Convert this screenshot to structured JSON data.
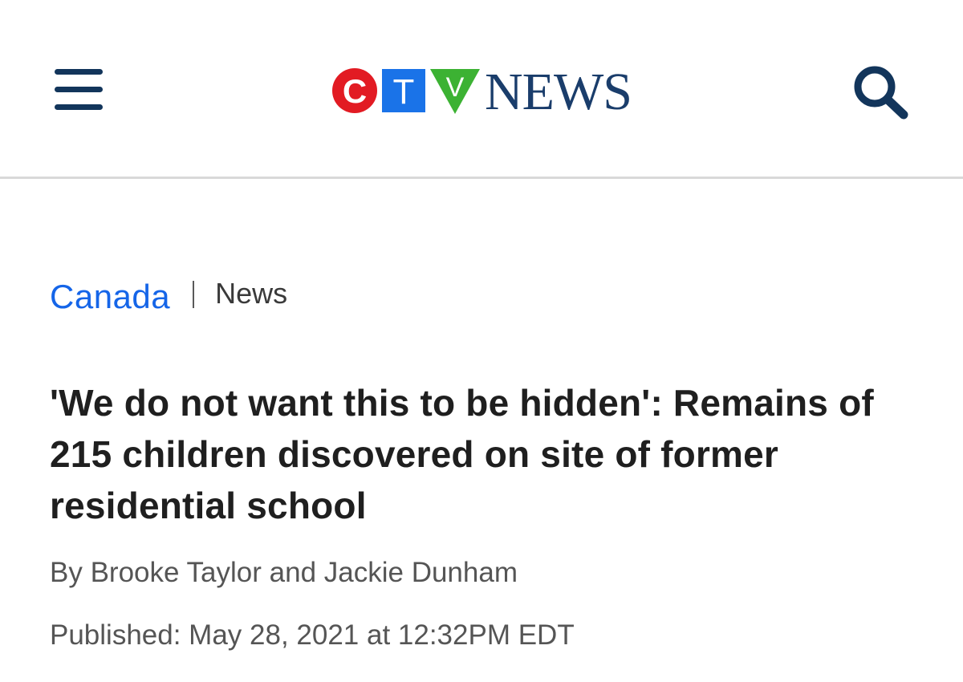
{
  "header": {
    "menu_icon": "hamburger-menu-icon",
    "search_icon": "search-icon",
    "logo": {
      "letters": [
        "C",
        "T",
        "V"
      ],
      "news_text": "NEWS",
      "colors": {
        "c_red": "#e21b23",
        "t_blue": "#1a73e8",
        "v_green": "#3cb233",
        "news_navy": "#1a3d6b"
      }
    },
    "icon_color": "#12355b"
  },
  "article": {
    "section": "Canada",
    "subsection": "News",
    "headline": "'We do not want this to be hidden': Remains of 215 children discovered on site of former residential school",
    "byline": "By Brooke Taylor and Jackie Dunham",
    "published": "Published: May 28, 2021 at 12:32PM EDT"
  },
  "colors": {
    "section_link": "#1565e8",
    "headline": "#1f1f1f",
    "meta_text": "#555555",
    "divider": "#d9d9d9"
  }
}
